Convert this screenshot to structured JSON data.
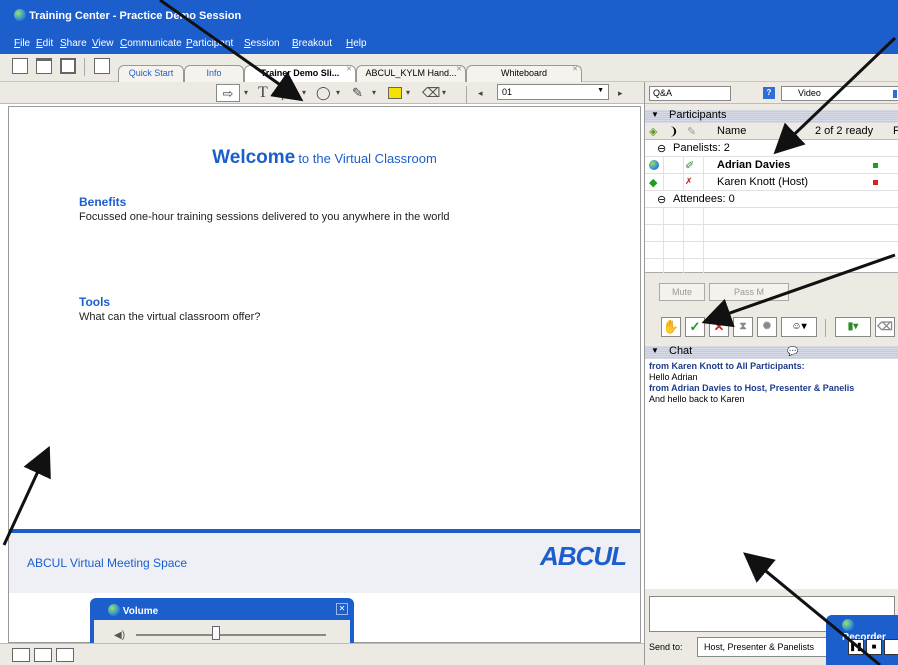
{
  "window": {
    "title": "Training Center - Practice Demo Session"
  },
  "menu": [
    "File",
    "Edit",
    "Share",
    "View",
    "Communicate",
    "Participant",
    "Session",
    "Breakout",
    "Help"
  ],
  "tabs": [
    {
      "label": "Quick Start"
    },
    {
      "label": "Info"
    },
    {
      "label": "Trainer Demo Sli...",
      "active": true
    },
    {
      "label": "ABCUL_KYLM Hand..."
    },
    {
      "label": "Whiteboard"
    }
  ],
  "drawing_toolbar": {
    "page_value": "01"
  },
  "slide": {
    "welcome_big": "Welcome",
    "welcome_small": "to the Virtual Classroom",
    "benefits_heading": "Benefits",
    "benefits_text": "Focussed one-hour training sessions delivered to you anywhere in the world",
    "tools_heading": "Tools",
    "tools_text": "What can the virtual classroom offer?",
    "footer_text": "ABCUL Virtual Meeting Space",
    "logo_text": "ABCUL"
  },
  "volume_panel": {
    "title": "Volume",
    "level": 0.42
  },
  "right_panel": {
    "qa_label": "Q&A",
    "video_label": "Video",
    "participants_header": "Participants",
    "name_column": "Name",
    "ready_status": "2 of 2 ready",
    "ready_extra": "F",
    "panelists_label": "Panelists: 2",
    "participants": [
      {
        "name": "Adrian Davies",
        "bold": true,
        "status_color": "#1aa01a"
      },
      {
        "name": "Karen Knott (Host)",
        "bold": false,
        "status_color": "#e02020"
      }
    ],
    "attendees_label": "Attendees: 0",
    "mute_label": "Mute",
    "pass_label": "Pass M",
    "chat_header": "Chat",
    "chat": [
      {
        "from": "from Karen Knott to All Participants:",
        "message": "Hello Adrian"
      },
      {
        "from": "from Adrian Davies to Host, Presenter & Panelis",
        "message": "And hello back to Karen"
      }
    ],
    "send_to_label": "Send to:",
    "send_to_value": "Host, Presenter & Panelists"
  },
  "recorder": {
    "title": "Recorder"
  },
  "colors": {
    "accent": "#1c5fcc",
    "window_bg": "#eceae2"
  }
}
